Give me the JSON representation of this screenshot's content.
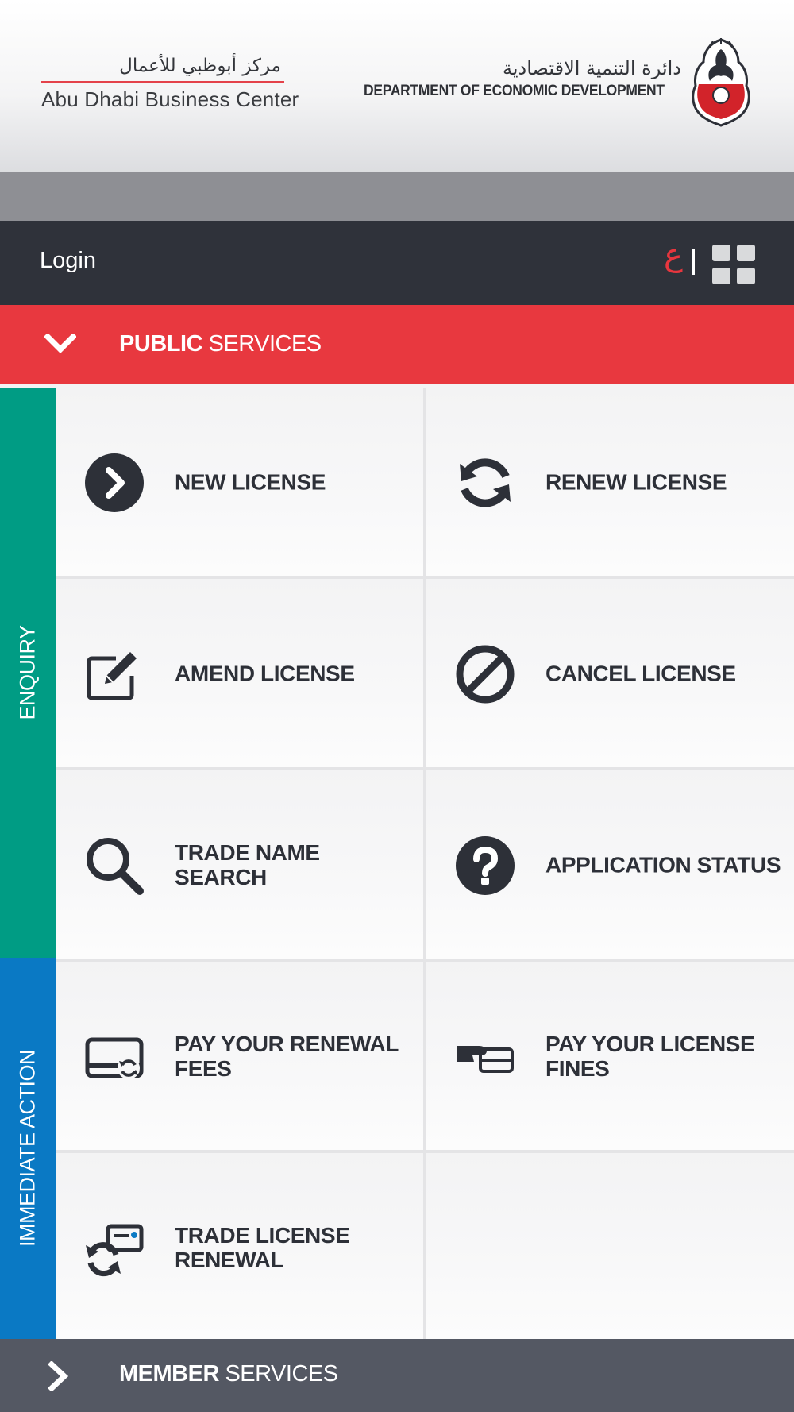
{
  "header": {
    "adbc_arabic": "مركز أبوظبي للأعمال",
    "adbc_english": "Abu Dhabi Business Center",
    "ded_arabic": "دائرة التنمية الاقتصادية",
    "ded_english": "DEPARTMENT OF ECONOMIC DEVELOPMENT"
  },
  "topbar": {
    "login": "Login",
    "language_toggle": "ع"
  },
  "public_services": {
    "bold": "PUBLIC",
    "rest": " SERVICES"
  },
  "side_tabs": {
    "enquiry": "ENQUIRY",
    "immediate_action": "IMMEDIATE ACTION"
  },
  "tiles": [
    {
      "label": "NEW LICENSE",
      "icon": "chevron-circle-icon"
    },
    {
      "label": "RENEW LICENSE",
      "icon": "refresh-icon"
    },
    {
      "label": "AMEND LICENSE",
      "icon": "edit-icon"
    },
    {
      "label": "CANCEL LICENSE",
      "icon": "ban-icon"
    },
    {
      "label": "TRADE NAME SEARCH",
      "icon": "search-icon"
    },
    {
      "label": "APPLICATION STATUS",
      "icon": "question-icon"
    },
    {
      "label": "PAY YOUR RENEWAL FEES",
      "icon": "card-renew-icon"
    },
    {
      "label": "PAY YOUR LICENSE FINES",
      "icon": "hand-card-icon"
    },
    {
      "label": "TRADE LICENSE RENEWAL",
      "icon": "license-renew-icon"
    }
  ],
  "member_services": {
    "bold": "MEMBER",
    "rest": " SERVICES"
  },
  "colors": {
    "red": "#e8383f",
    "dark": "#2f323a",
    "teal": "#009c84",
    "blue": "#0a79c4",
    "member": "#545863",
    "icon": "#2d3038"
  }
}
